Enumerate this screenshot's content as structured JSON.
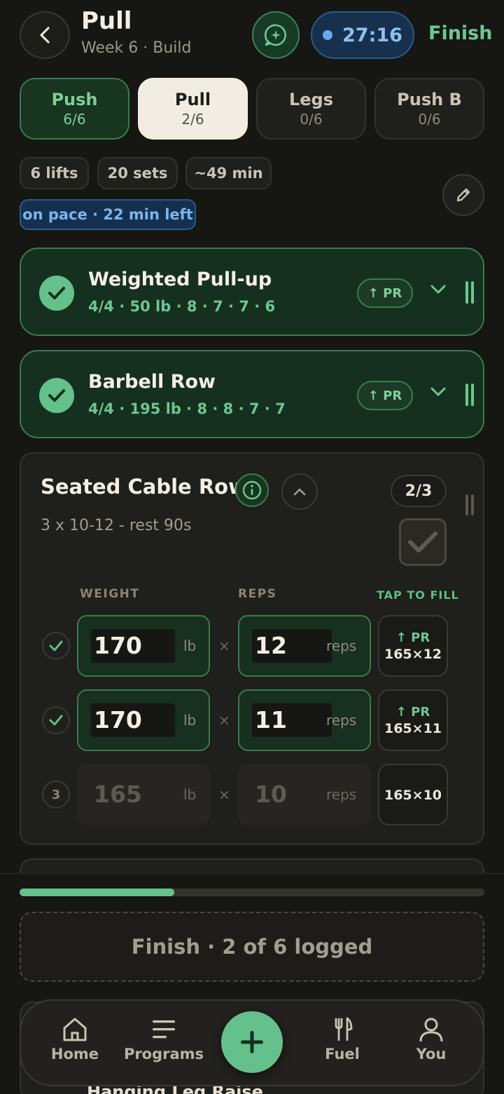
{
  "header": {
    "title": "Pull",
    "subtitle": "Week 6 · Build",
    "timer": "27:16",
    "finish_label": "Finish"
  },
  "tabs": [
    {
      "name": "Push",
      "count": "6/6",
      "state": "done"
    },
    {
      "name": "Pull",
      "count": "2/6",
      "state": "active"
    },
    {
      "name": "Legs",
      "count": "0/6",
      "state": "idle"
    },
    {
      "name": "Push B",
      "count": "0/6",
      "state": "idle"
    }
  ],
  "summary": {
    "lifts": "6 lifts",
    "sets": "20 sets",
    "duration": "~49 min",
    "pace": "on pace · 22 min left"
  },
  "completed": [
    {
      "name": "Weighted Pull-up",
      "detail": "4/4 · 50 lb · 8 · 7 · 7 · 6",
      "badge": "↑ PR"
    },
    {
      "name": "Barbell Row",
      "detail": "4/4 · 195 lb · 8 · 8 · 7 · 7",
      "badge": "↑ PR"
    }
  ],
  "active": {
    "name": "Seated Cable Row",
    "desc": "3 x 10-12 - rest 90s",
    "progress": "2/3",
    "col_weight": "WEIGHT",
    "col_reps": "REPS",
    "col_fill": "TAP TO FILL",
    "weight_unit": "lb",
    "reps_unit": "reps",
    "times": "×",
    "sets": [
      {
        "status": "",
        "weight": "170",
        "reps": "12",
        "hint_pr": "↑ PR",
        "hint_prev": "165×12",
        "done": true
      },
      {
        "status": "",
        "weight": "170",
        "reps": "11",
        "hint_pr": "↑ PR",
        "hint_prev": "165×11",
        "done": true
      },
      {
        "status": "3",
        "weight": "165",
        "reps": "10",
        "hint_pr": "",
        "hint_prev": "165×10",
        "done": false
      }
    ]
  },
  "session_progress": 0.333,
  "finish_button": "Finish · 2 of 6 logged",
  "next_exercise_peek": "Hanging Leg Raise",
  "nav": {
    "home": "Home",
    "programs": "Programs",
    "fuel": "Fuel",
    "you": "You"
  },
  "colors": {
    "accent": "#65c18c",
    "blue": "#8cc0f2",
    "background": "#161612"
  }
}
